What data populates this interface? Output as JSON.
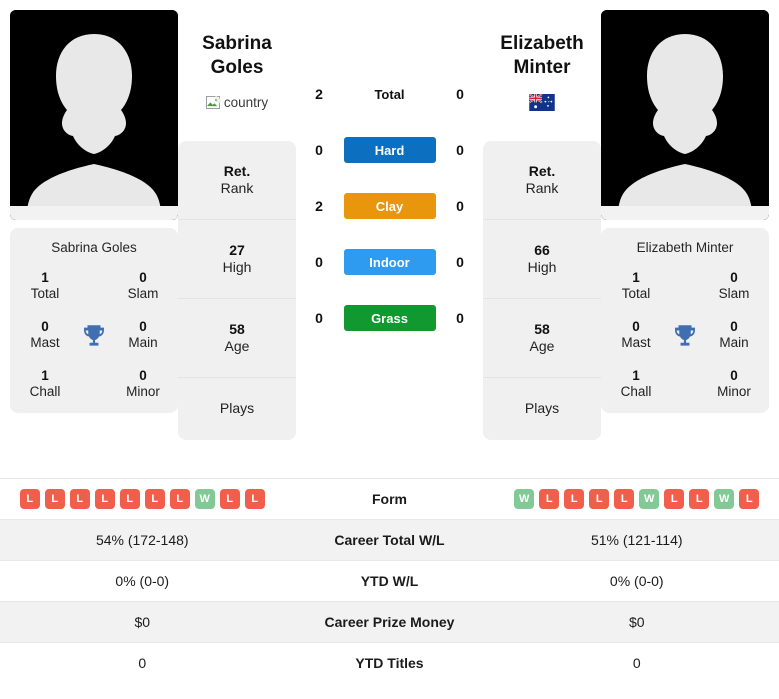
{
  "players": {
    "left": {
      "first_name": "Sabrina",
      "last_name": "Goles",
      "full_name": "Sabrina Goles",
      "country_alt": "country",
      "country_image_broken": true,
      "avatar": "player-silhouette-placeholder",
      "rank_stats": [
        {
          "value": "Ret.",
          "label": "Rank"
        },
        {
          "value": "27",
          "label": "High"
        },
        {
          "value": "58",
          "label": "Age"
        },
        {
          "value": "",
          "label": "Plays"
        }
      ],
      "titles": [
        {
          "value": "1",
          "label": "Total"
        },
        {
          "value": "0",
          "label": "Slam"
        },
        {
          "value": "0",
          "label": "Mast"
        },
        {
          "value": "0",
          "label": "Main"
        },
        {
          "value": "1",
          "label": "Chall"
        },
        {
          "value": "0",
          "label": "Minor"
        }
      ],
      "form": [
        "L",
        "L",
        "L",
        "L",
        "L",
        "L",
        "L",
        "W",
        "L",
        "L"
      ],
      "career_total_wl": "54% (172-148)",
      "ytd_wl": "0% (0-0)",
      "career_prize_money": "$0",
      "ytd_titles": "0"
    },
    "right": {
      "first_name": "Elizabeth",
      "last_name": "Minter",
      "full_name": "Elizabeth Minter",
      "country_alt": "Australia",
      "country_image_broken": false,
      "avatar": "player-silhouette-placeholder",
      "rank_stats": [
        {
          "value": "Ret.",
          "label": "Rank"
        },
        {
          "value": "66",
          "label": "High"
        },
        {
          "value": "58",
          "label": "Age"
        },
        {
          "value": "",
          "label": "Plays"
        }
      ],
      "titles": [
        {
          "value": "1",
          "label": "Total"
        },
        {
          "value": "0",
          "label": "Slam"
        },
        {
          "value": "0",
          "label": "Mast"
        },
        {
          "value": "0",
          "label": "Main"
        },
        {
          "value": "1",
          "label": "Chall"
        },
        {
          "value": "0",
          "label": "Minor"
        }
      ],
      "form": [
        "W",
        "L",
        "L",
        "L",
        "L",
        "W",
        "L",
        "L",
        "W",
        "L"
      ],
      "career_total_wl": "51% (121-114)",
      "ytd_wl": "0% (0-0)",
      "career_prize_money": "$0",
      "ytd_titles": "0"
    }
  },
  "surfaces": [
    {
      "label": "Total",
      "left": "2",
      "right": "0",
      "color": "",
      "plain": true
    },
    {
      "label": "Hard",
      "left": "0",
      "right": "0",
      "color": "#0d6fc0",
      "plain": false
    },
    {
      "label": "Clay",
      "left": "2",
      "right": "0",
      "color": "#e8960c",
      "plain": false
    },
    {
      "label": "Indoor",
      "left": "0",
      "right": "0",
      "color": "#2e9bf0",
      "plain": false
    },
    {
      "label": "Grass",
      "left": "0",
      "right": "0",
      "color": "#11992f",
      "plain": false
    }
  ],
  "table_rows": [
    {
      "label": "Form",
      "type": "form",
      "left": "",
      "right": ""
    },
    {
      "label": "Career Total W/L",
      "type": "text",
      "left": "54% (172-148)",
      "right": "51% (121-114)"
    },
    {
      "label": "YTD W/L",
      "type": "text",
      "left": "0% (0-0)",
      "right": "0% (0-0)"
    },
    {
      "label": "Career Prize Money",
      "type": "text",
      "left": "$0",
      "right": "$0"
    },
    {
      "label": "YTD Titles",
      "type": "text",
      "left": "0",
      "right": "0"
    }
  ],
  "colors": {
    "win_badge": "#82c995",
    "loss_badge": "#ef5f4c",
    "trophy": "#3f6fb0",
    "card_bg": "#f0f0f0",
    "row_alt_bg": "#f2f2f2"
  },
  "icons": {
    "trophy": "trophy-icon",
    "broken_image": "broken-image-icon",
    "flag_au": "australia-flag-icon"
  }
}
